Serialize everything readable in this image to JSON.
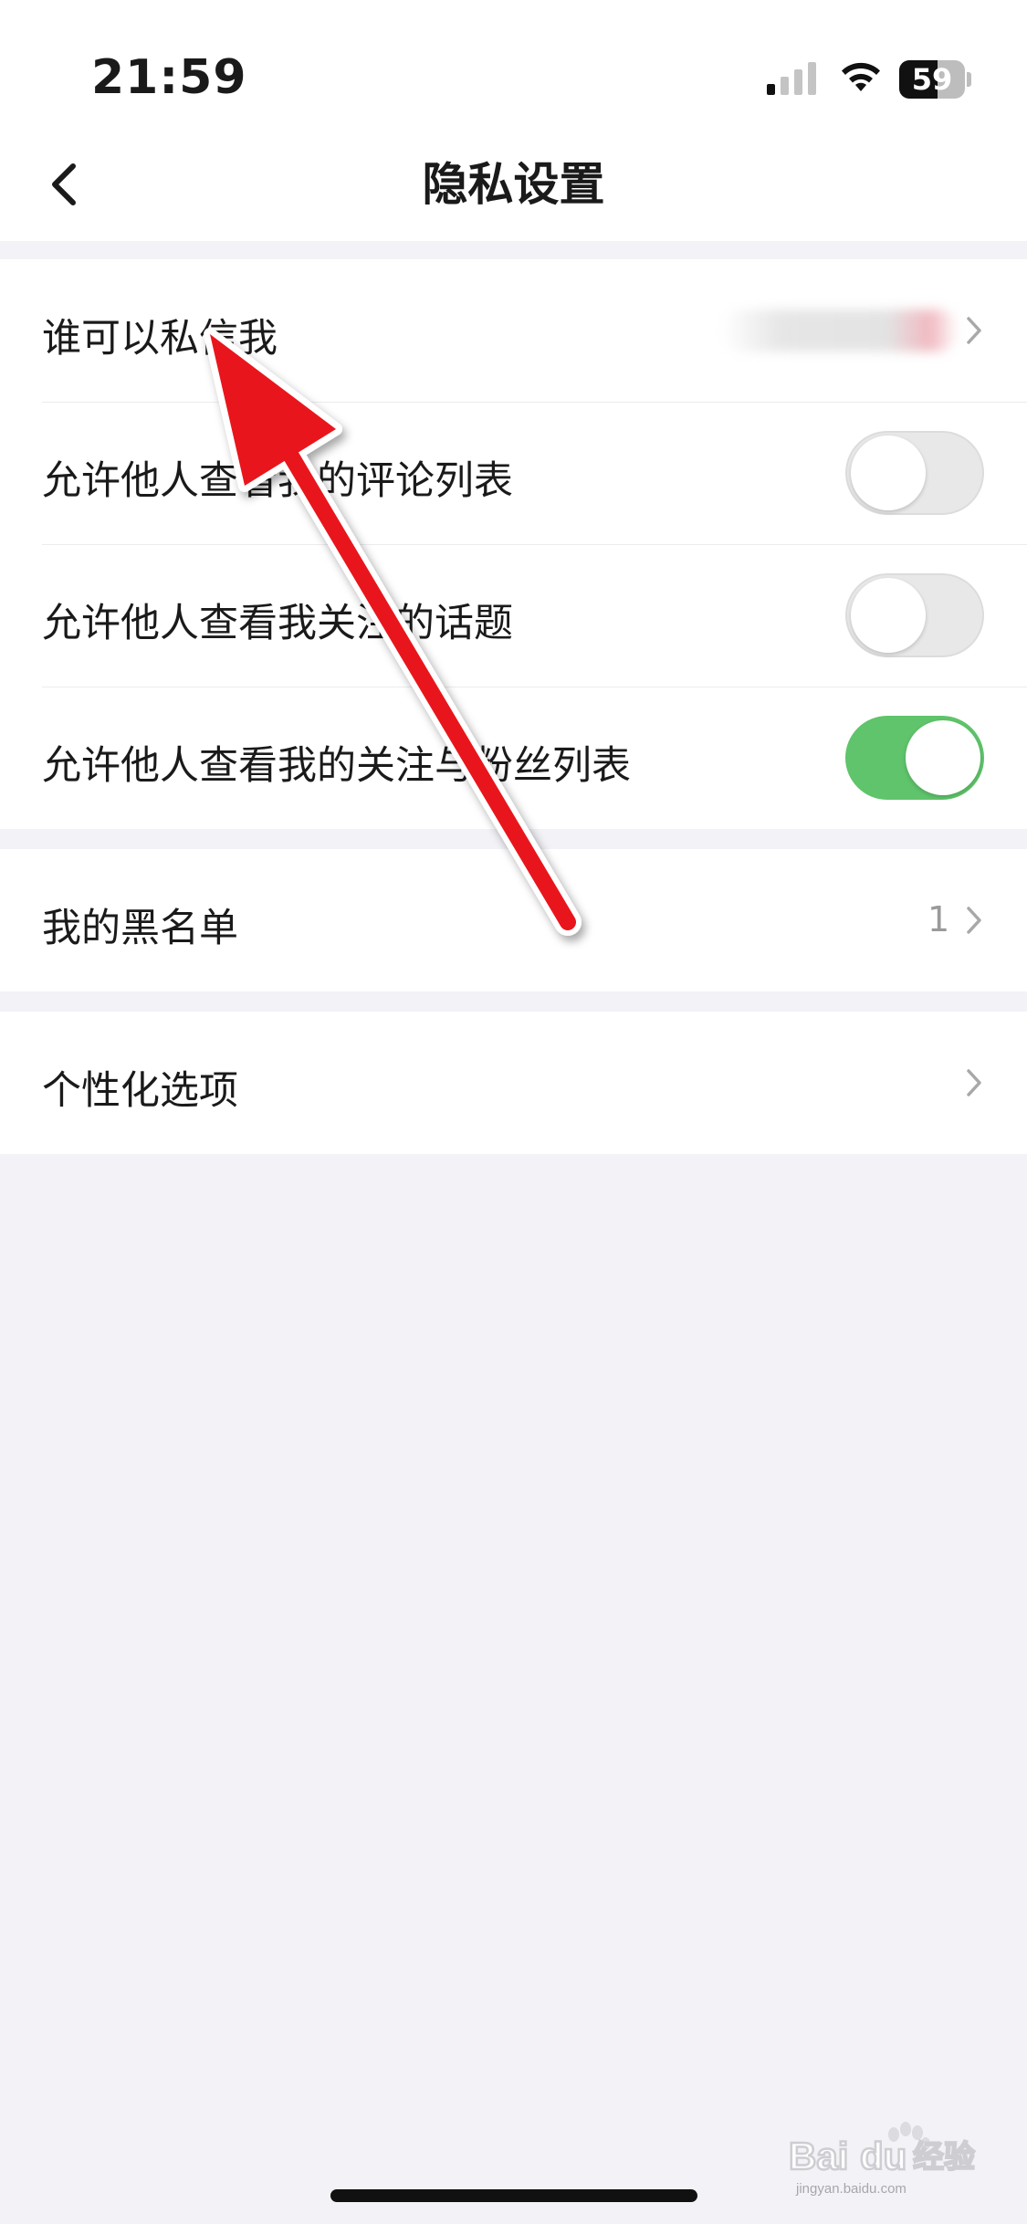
{
  "status_bar": {
    "time": "21:59",
    "battery_level": "59",
    "signal_icon": "cellular-signal-icon",
    "wifi_icon": "wifi-icon"
  },
  "nav": {
    "title": "隐私设置",
    "back_icon": "chevron-left-icon"
  },
  "privacy_group": {
    "items": [
      {
        "label": "谁可以私信我",
        "value_blurred": true
      },
      {
        "label": "允许他人查看我的评论列表",
        "toggle_on": false
      },
      {
        "label": "允许他人查看我关注的话题",
        "toggle_on": false
      },
      {
        "label": "允许他人查看我的关注与粉丝列表",
        "toggle_on": true
      }
    ]
  },
  "blacklist_group": {
    "label": "我的黑名单",
    "count": "1"
  },
  "personalization_group": {
    "label": "个性化选项"
  },
  "watermark": {
    "brand": "Bai",
    "brand_end": "du",
    "suffix": "经验",
    "url": "jingyan.baidu.com"
  },
  "colors": {
    "toggle_on": "#5fc46b",
    "toggle_off": "#e8e8e8",
    "background": "#f2f2f7",
    "annotation_arrow": "#e8141c"
  }
}
